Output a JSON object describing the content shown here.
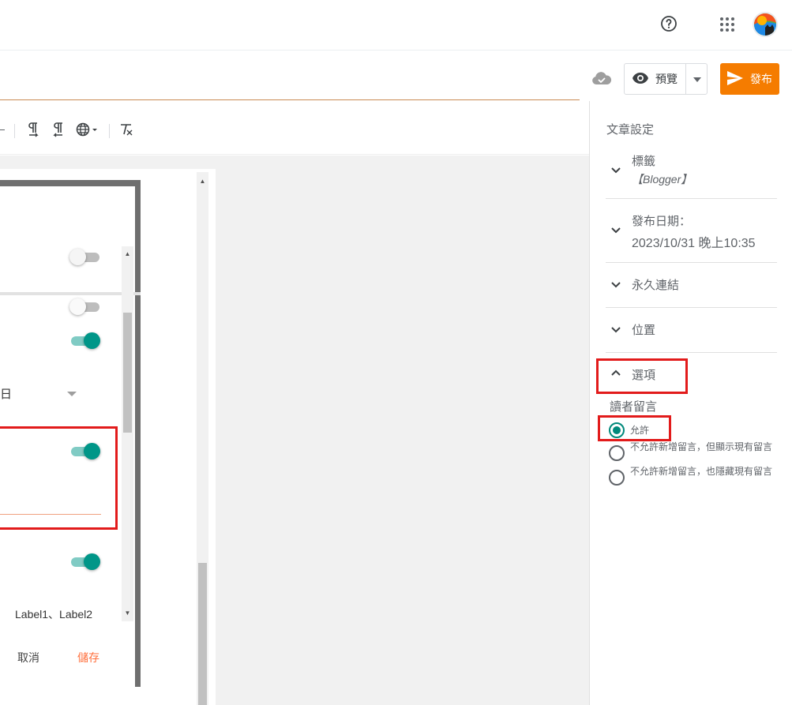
{
  "header": {
    "help_icon": "help-circle-icon",
    "apps_icon": "apps-grid-icon",
    "avatar_icon": "user-avatar"
  },
  "actions": {
    "preview_label": "預覽",
    "publish_label": "發布",
    "publish_color": "#f57c00"
  },
  "toolbar": {
    "icons": [
      "paragraph-ltr-icon",
      "paragraph-rtl-icon",
      "language-globe-icon",
      "clear-formatting-icon"
    ]
  },
  "embedded_screenshot": {
    "date_char": "日",
    "labels_value": "Label1、Label2",
    "cancel_label": "取消",
    "save_label": "儲存",
    "toggles": [
      false,
      false,
      true,
      true,
      true
    ],
    "accent_color": "#009688"
  },
  "settings": {
    "title": "文章設定",
    "sections": [
      {
        "label": "標籤",
        "value": "【Blogger】",
        "expanded": false
      },
      {
        "label": "發布日期：",
        "value": "2023/10/31 晚上10:35",
        "expanded": false
      },
      {
        "label": "永久連結",
        "expanded": false
      },
      {
        "label": "位置",
        "expanded": false
      },
      {
        "label": "選項",
        "expanded": true
      }
    ],
    "reader_comments": {
      "title": "讀者留言",
      "options": [
        {
          "label": "允許",
          "checked": true
        },
        {
          "label": "不允許新增留言，但顯示現有留言",
          "checked": false
        },
        {
          "label": "不允許新增留言，也隱藏現有留言",
          "checked": false
        }
      ]
    }
  }
}
